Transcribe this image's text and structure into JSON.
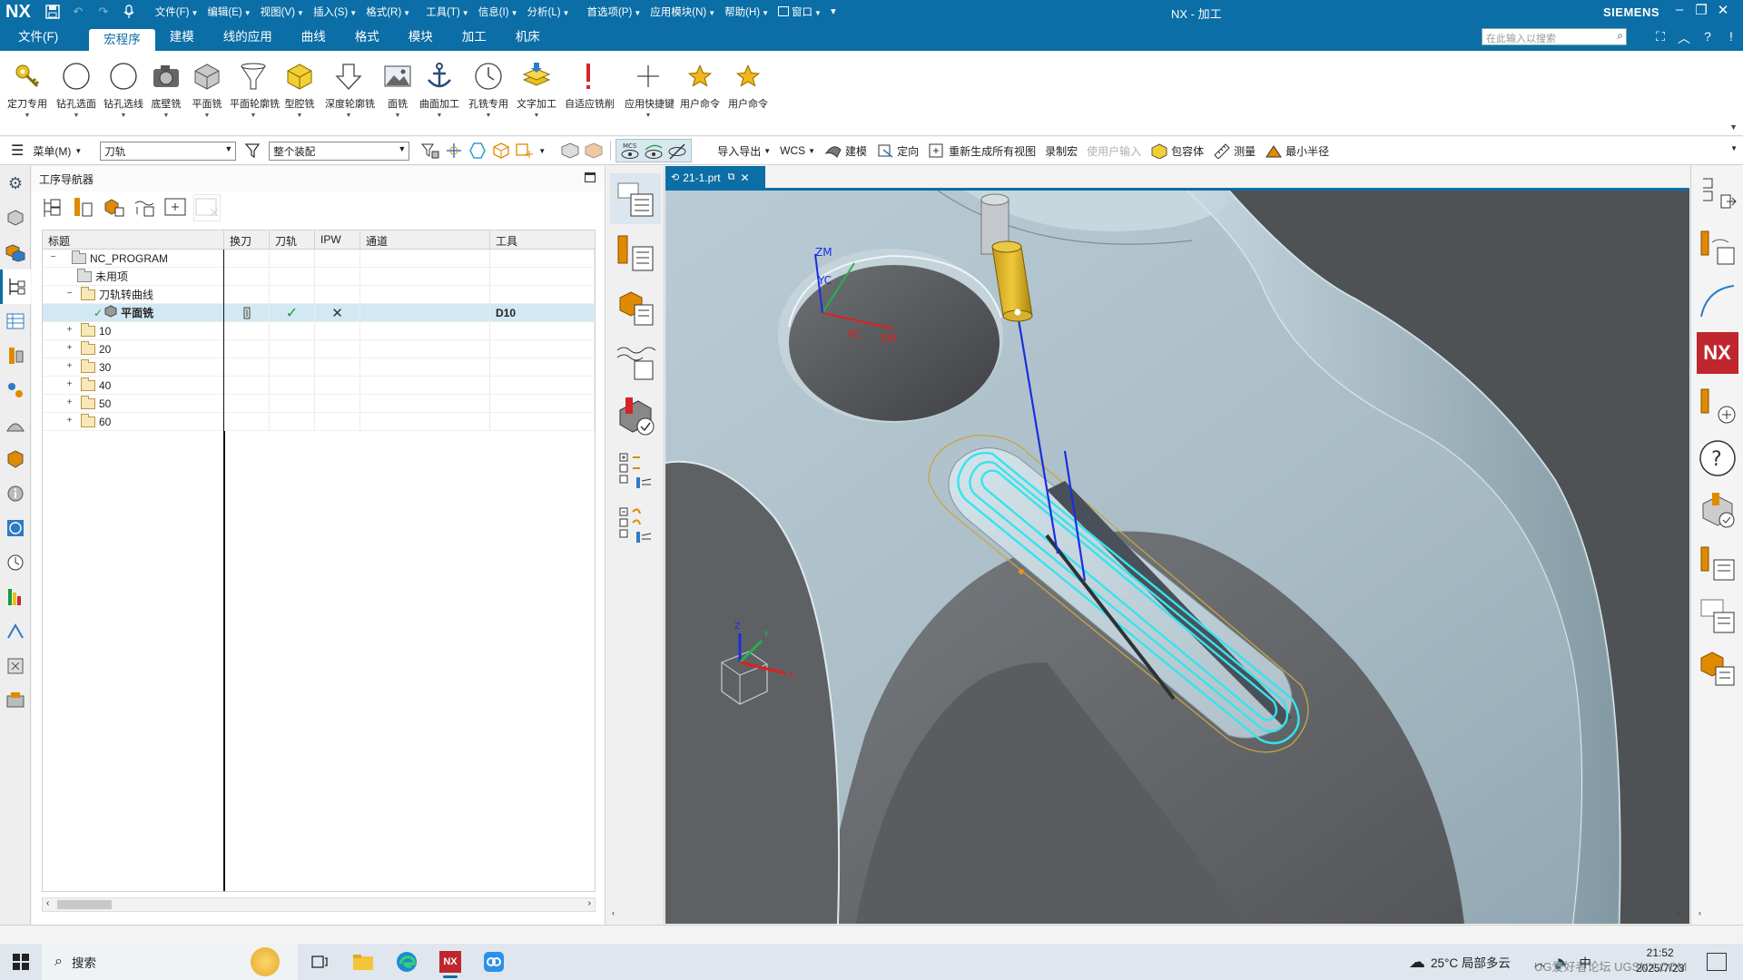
{
  "titlebar": {
    "logo": "NX",
    "menus": [
      {
        "label": "文件(F)"
      },
      {
        "label": "编辑(E)"
      },
      {
        "label": "视图(V)"
      },
      {
        "label": "插入(S)"
      },
      {
        "label": "格式(R)"
      },
      {
        "label": "工具(T)"
      },
      {
        "label": "信息(I)"
      },
      {
        "label": "分析(L)"
      },
      {
        "label": "首选项(P)"
      },
      {
        "label": "应用模块(N)"
      },
      {
        "label": "帮助(H)"
      },
      {
        "label": "窗口"
      }
    ],
    "title": "NX - 加工",
    "brand": "SIEMENS"
  },
  "ribbon_tabs": [
    {
      "label": "文件(F)"
    },
    {
      "label": "宏程序"
    },
    {
      "label": "建模"
    },
    {
      "label": "线的应用"
    },
    {
      "label": "曲线"
    },
    {
      "label": "格式"
    },
    {
      "label": "模块"
    },
    {
      "label": "加工"
    },
    {
      "label": "机床"
    }
  ],
  "active_tab": "宏程序",
  "search": {
    "placeholder": "在此输入以搜索"
  },
  "ribbon_buttons": [
    {
      "label": "定刀专用",
      "icon": "key-icon"
    },
    {
      "label": "钻孔选面",
      "icon": "circle-icon"
    },
    {
      "label": "钻孔选线",
      "icon": "circle-icon"
    },
    {
      "label": "底壁铣",
      "icon": "camera-icon"
    },
    {
      "label": "平面铣",
      "icon": "cube-icon"
    },
    {
      "label": "平面轮廓铣",
      "icon": "funnel-icon"
    },
    {
      "label": "型腔铣",
      "icon": "yellow-cube-icon"
    },
    {
      "label": "深度轮廓铣",
      "icon": "down-arrow-icon"
    },
    {
      "label": "面铣",
      "icon": "image-icon"
    },
    {
      "label": "曲面加工",
      "icon": "anchor-icon"
    },
    {
      "label": "孔铣专用",
      "icon": "clock-icon"
    },
    {
      "label": "文字加工",
      "icon": "layers-icon"
    },
    {
      "label": "自适应铣削",
      "icon": "exclamation-icon"
    },
    {
      "label": "应用快捷键",
      "icon": "plus-icon"
    },
    {
      "label": "用户命令",
      "icon": "star-icon"
    },
    {
      "label": "用户命令",
      "icon": "star-icon"
    }
  ],
  "toolbar": {
    "menu_label": "菜单(M)",
    "filter_value": "刀轨",
    "assembly_value": "整个装配",
    "import_export": "导入导出",
    "wcs": "WCS",
    "modeling": "建模",
    "orient": "定向",
    "regenerate": "重新生成所有视图",
    "record_macro": "录制宏",
    "user_input": "使用户输入",
    "envelope": "包容体",
    "measure": "测量",
    "min_radius": "最小半径"
  },
  "navigator": {
    "title": "工序导航器",
    "columns": [
      "标题",
      "换刀",
      "刀轨",
      "IPW",
      "通道",
      "工具"
    ],
    "rows": [
      {
        "title": "NC_PROGRAM",
        "level": 0,
        "expander": "−",
        "tool": ""
      },
      {
        "title": "未用项",
        "level": 1,
        "expander": "",
        "tool": ""
      },
      {
        "title": "刀轨转曲线",
        "level": 1,
        "expander": "−",
        "tool": ""
      },
      {
        "title": "平面铣",
        "level": 2,
        "expander": "",
        "tool": "D10",
        "selected": true
      },
      {
        "title": "10",
        "level": 1,
        "expander": "+",
        "tool": ""
      },
      {
        "title": "20",
        "level": 1,
        "expander": "+",
        "tool": ""
      },
      {
        "title": "30",
        "level": 1,
        "expander": "+",
        "tool": ""
      },
      {
        "title": "40",
        "level": 1,
        "expander": "+",
        "tool": ""
      },
      {
        "title": "50",
        "level": 1,
        "expander": "+",
        "tool": ""
      },
      {
        "title": "60",
        "level": 1,
        "expander": "+",
        "tool": ""
      }
    ]
  },
  "graphics": {
    "file_tab": "21-1.prt",
    "axis_labels": {
      "zm": "ZM",
      "yc": "YC",
      "xc": "XC",
      "xm": "XM"
    },
    "triad_labels": {
      "z": "Z",
      "y": "Y",
      "x": "X"
    }
  },
  "taskbar": {
    "search": "搜索",
    "weather": "25°C 局部多云",
    "ime": "中",
    "time": "21:52",
    "date": "2025/7/23",
    "watermark": "UG爱好者论坛 UGSNX.COM"
  }
}
